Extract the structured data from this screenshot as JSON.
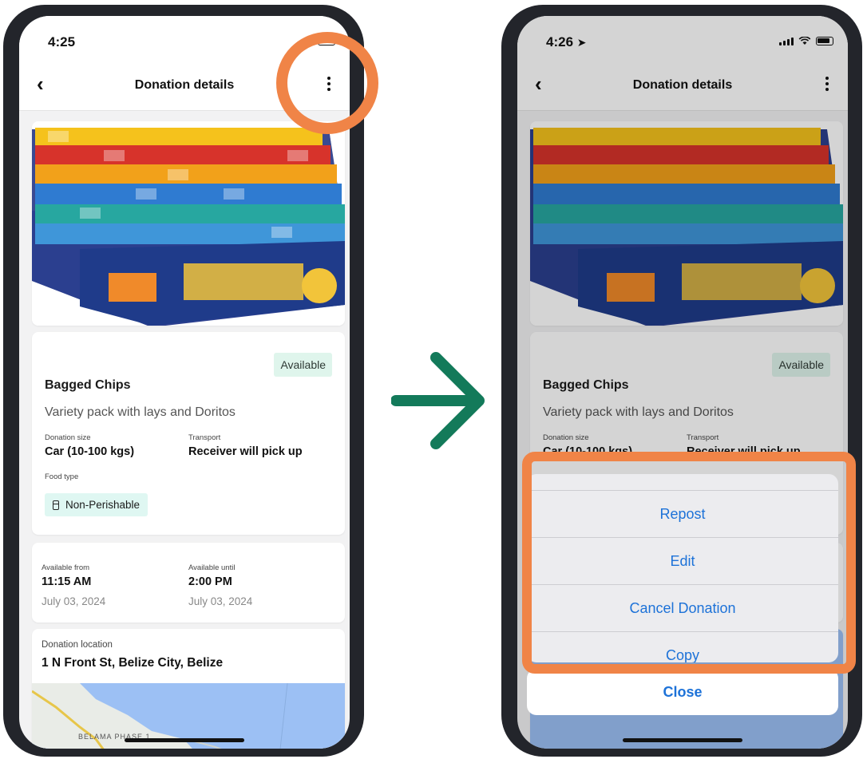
{
  "left_screen": {
    "status": {
      "time": "4:25"
    },
    "nav": {
      "title": "Donation details"
    },
    "donation": {
      "badge": "Available",
      "title": "Bagged Chips",
      "description": "Variety pack with lays and Doritos",
      "size_label": "Donation size",
      "size_value": "Car (10-100 kgs)",
      "transport_label": "Transport",
      "transport_value": "Receiver will pick up",
      "food_type_label": "Food type",
      "food_type_value": "Non-Perishable"
    },
    "availability": {
      "from_label": "Available from",
      "from_time": "11:15 AM",
      "from_date": "July 03, 2024",
      "until_label": "Available until",
      "until_time": "2:00 PM",
      "until_date": "July 03, 2024"
    },
    "location": {
      "label": "Donation location",
      "address": "1 N Front St, Belize City, Belize",
      "map_label": "BELAMA PHASE 1"
    }
  },
  "right_screen": {
    "status": {
      "time": "4:26"
    },
    "nav": {
      "title": "Donation details"
    },
    "donation": {
      "badge": "Available",
      "title": "Bagged Chips",
      "description": "Variety pack with lays and Doritos",
      "size_label": "Donation size",
      "size_value": "Car (10-100 kgs)",
      "transport_label": "Transport",
      "transport_value": "Receiver will pick up"
    },
    "action_sheet": {
      "actions": [
        "Repost",
        "Edit",
        "Cancel Donation",
        "Copy"
      ],
      "close_label": "Close"
    }
  },
  "colors": {
    "annotation": "#f08447",
    "arrow": "#137a5a",
    "ios_blue": "#1d72d8",
    "badge_bg": "#dff5ec",
    "food_tag_bg": "#dff7f2"
  },
  "icons": [
    "back-chevron-icon",
    "more-vertical-icon",
    "jar-icon",
    "location-arrow-icon",
    "signal-icon",
    "wifi-icon",
    "battery-icon",
    "right-arrow-icon"
  ]
}
